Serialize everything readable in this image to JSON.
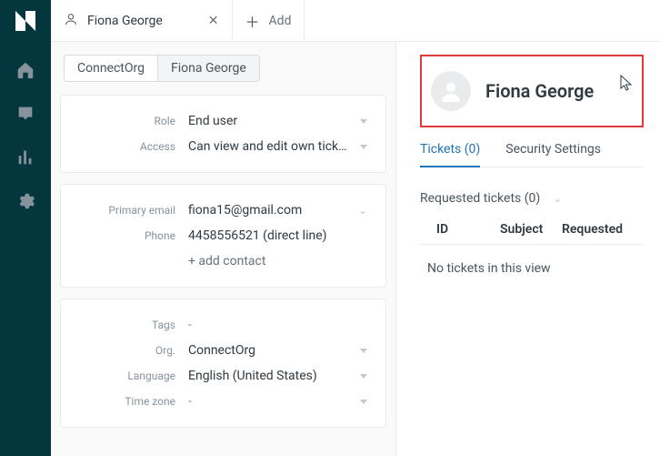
{
  "tabs": {
    "active_label": "Fiona George",
    "add_label": "Add"
  },
  "breadcrumb": {
    "org": "ConnectOrg",
    "user": "Fiona George"
  },
  "fields": {
    "role": {
      "label": "Role",
      "value": "End user"
    },
    "access": {
      "label": "Access",
      "value": "Can view and edit own tick…"
    },
    "primary_email": {
      "label": "Primary email",
      "value": "fiona15@gmail.com"
    },
    "phone": {
      "label": "Phone",
      "value": "4458556521 (direct line)"
    },
    "add_contact": "+ add contact",
    "tags": {
      "label": "Tags",
      "value": "-"
    },
    "org": {
      "label": "Org.",
      "value": "ConnectOrg"
    },
    "language": {
      "label": "Language",
      "value": "English (United States)"
    },
    "timezone": {
      "label": "Time zone",
      "value": "-"
    }
  },
  "profile": {
    "name": "Fiona George"
  },
  "subtabs": {
    "tickets": "Tickets (0)",
    "security": "Security Settings"
  },
  "tickets": {
    "section_title": "Requested tickets (0)",
    "col_id": "ID",
    "col_subject": "Subject",
    "col_requested": "Requested",
    "empty": "No tickets in this view"
  }
}
